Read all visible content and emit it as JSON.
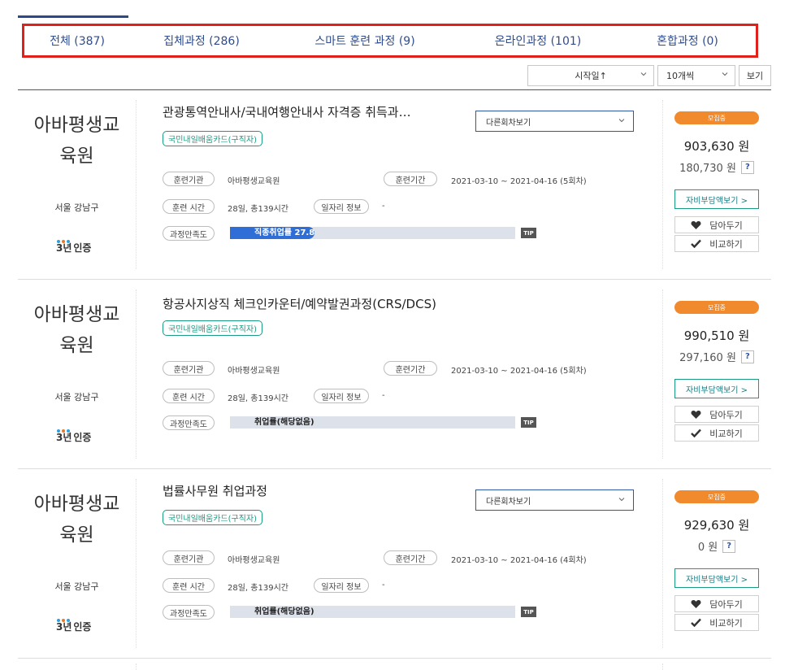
{
  "tabs": [
    {
      "label": "전체 (387)"
    },
    {
      "label": "집체과정 (286)"
    },
    {
      "label": "스마트 훈련 과정 (9)"
    },
    {
      "label": "온라인과정 (101)"
    },
    {
      "label": "혼합과정 (0)"
    }
  ],
  "sortbar": {
    "sort_value": "시작일↑",
    "count_value": "10개씩",
    "view_label": "보기"
  },
  "labels": {
    "institution": "훈련기관",
    "period": "훈련기간",
    "time": "훈련 시간",
    "jobs": "일자리 정보",
    "satisfaction": "과정만족도",
    "tip": "TIP",
    "cert_num": "3년",
    "cert_word": "인증",
    "selfpay": "자비부담액보기 >",
    "save": "담아두기",
    "compare": "비교하기",
    "sessions": "다른회차보기",
    "status": "모집중",
    "badge": "국민내일배움카드(구직자)"
  },
  "courses": [
    {
      "institution_name": "아바평생교육원",
      "location": "서울 강남구",
      "title": "관광통역안내사/국내여행안내사 자격증 취득과…",
      "institution": "아바평생교육원",
      "period": "2021-03-10 ~ 2021-04-16 (5회차)",
      "time": "28일, 총139시간",
      "jobs": "-",
      "rate_label": "직종취업률 27.8",
      "rate": 27.8,
      "price": "903,630 원",
      "subsidy": "180,730 원",
      "has_sessions": true
    },
    {
      "institution_name": "아바평생교육원",
      "location": "서울 강남구",
      "title": "항공사지상직 체크인카운터/예약발권과정(CRS/DCS)",
      "institution": "아바평생교육원",
      "period": "2021-03-10 ~ 2021-04-16 (5회차)",
      "time": "28일, 총139시간",
      "jobs": "-",
      "rate_label": "취업률(해당없음)",
      "rate": 0,
      "price": "990,510 원",
      "subsidy": "297,160 원",
      "has_sessions": false
    },
    {
      "institution_name": "아바평생교육원",
      "location": "서울 강남구",
      "title": "법률사무원 취업과정",
      "institution": "아바평생교육원",
      "period": "2021-03-10 ~ 2021-04-16 (4회차)",
      "time": "28일, 총139시간",
      "jobs": "-",
      "rate_label": "취업률(해당없음)",
      "rate": 0,
      "price": "929,630 원",
      "subsidy": "0 원",
      "has_sessions": true
    }
  ],
  "colors": {
    "tab_text": "#2f4d8e",
    "highlight_border": "#e0201b",
    "badge_green": "#1a9c84",
    "status_orange": "#f08a2c",
    "bar_blue": "#2f6ed6"
  }
}
